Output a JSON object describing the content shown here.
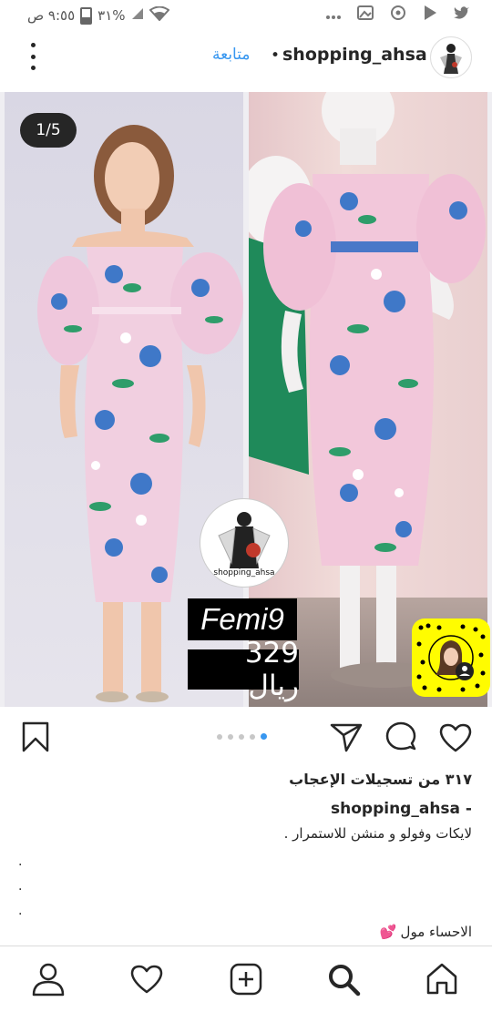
{
  "status_bar": {
    "time": "٩:٥٥ ص",
    "battery": "٣١%",
    "icons": [
      "wifi-icon",
      "signal-icon",
      "battery-icon",
      "twitter-icon",
      "play-store-icon",
      "sync-icon",
      "image-icon",
      "more-dots-icon"
    ]
  },
  "post": {
    "username": "shopping_ahsa",
    "separator": "•",
    "follow_label": "متابعة",
    "photo": {
      "counter": "1/5",
      "logo_caption": "shopping_ahsa",
      "product_code": "Femi9",
      "price": "329 ريال"
    },
    "carousel": {
      "total": 5,
      "active_index": 4
    },
    "likes": "٣١٧ من تسجيلات الإعجاب",
    "caption_user": "shopping_ahsa -",
    "caption_text": "لايكات وفولو و منشن للاستمرار .",
    "caption_dots": [
      ".",
      ".",
      "."
    ],
    "caption_place": "الاحساء مول",
    "caption_emoji": "💕"
  },
  "bottom_nav": {
    "items": [
      "profile-icon",
      "activity-icon",
      "new-post-icon",
      "search-icon",
      "home-icon"
    ]
  },
  "colors": {
    "accent": "#3897f0",
    "text": "#262626",
    "snap_yellow": "#fffc00"
  }
}
